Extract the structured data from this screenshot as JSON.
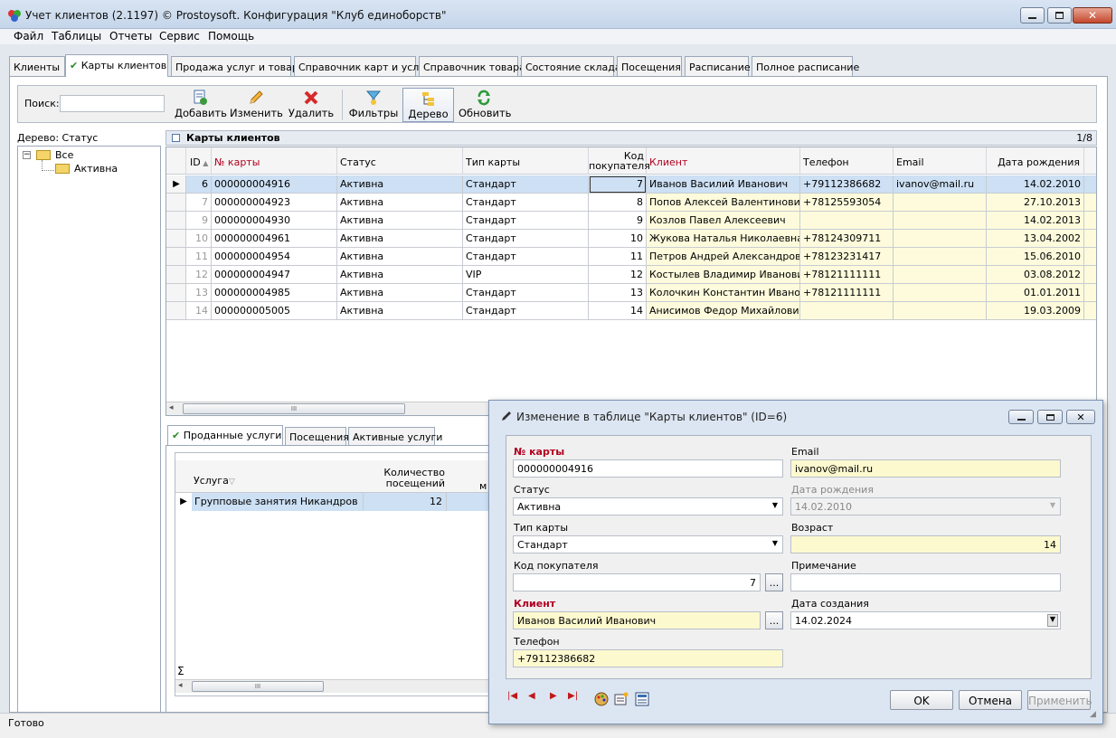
{
  "window": {
    "title": "Учет клиентов (2.1197) © Prostoysoft. Конфигурация \"Клуб единоборств\""
  },
  "menu": [
    "Файл",
    "Таблицы",
    "Отчеты",
    "Сервис",
    "Помощь"
  ],
  "tabs": [
    {
      "label": "Клиенты"
    },
    {
      "label": "Карты клиентов",
      "checkmark": "✔"
    },
    {
      "label": "Продажа услуг и товара"
    },
    {
      "label": "Справочник карт и услуг"
    },
    {
      "label": "Справочник товара"
    },
    {
      "label": "Состояние склада"
    },
    {
      "label": "Посещения"
    },
    {
      "label": "Расписание"
    },
    {
      "label": "Полное расписание"
    }
  ],
  "toolbar": {
    "search_label": "Поиск:",
    "search_value": "",
    "add": "Добавить",
    "edit": "Изменить",
    "delete": "Удалить",
    "filters": "Фильтры",
    "tree": "Дерево",
    "refresh": "Обновить"
  },
  "tree": {
    "title": "Дерево: Статус",
    "expander": "−",
    "root": "Все",
    "child": "Активна"
  },
  "grid": {
    "title": "Карты клиентов",
    "pager": "1/8",
    "row_pointer": "▶",
    "columns": {
      "id": "ID",
      "card_no": "№ карты",
      "status": "Статус",
      "card_type": "Тип карты",
      "buyer_code": "Код покупателя",
      "client": "Клиент",
      "phone": "Телефон",
      "email": "Email",
      "birthdate": "Дата рождения"
    },
    "rows": [
      {
        "id": "6",
        "card": "000000004916",
        "status": "Активна",
        "type": "Стандарт",
        "code": "7",
        "client": "Иванов Василий Иванович",
        "phone": "+79112386682",
        "email": "ivanov@mail.ru",
        "birth": "14.02.2010"
      },
      {
        "id": "7",
        "card": "000000004923",
        "status": "Активна",
        "type": "Стандарт",
        "code": "8",
        "client": "Попов Алексей Валентинович",
        "phone": "+78125593054",
        "email": "",
        "birth": "27.10.2013"
      },
      {
        "id": "9",
        "card": "000000004930",
        "status": "Активна",
        "type": "Стандарт",
        "code": "9",
        "client": "Козлов Павел Алексеевич",
        "phone": "",
        "email": "",
        "birth": "14.02.2013"
      },
      {
        "id": "10",
        "card": "000000004961",
        "status": "Активна",
        "type": "Стандарт",
        "code": "10",
        "client": "Жукова Наталья Николаевна",
        "phone": "+78124309711",
        "email": "",
        "birth": "13.04.2002"
      },
      {
        "id": "11",
        "card": "000000004954",
        "status": "Активна",
        "type": "Стандарт",
        "code": "11",
        "client": "Петров Андрей Александрович",
        "phone": "+78123231417",
        "email": "",
        "birth": "15.06.2010"
      },
      {
        "id": "12",
        "card": "000000004947",
        "status": "Активна",
        "type": "VIP",
        "code": "12",
        "client": "Костылев Владимир Иванович",
        "phone": "+78121111111",
        "email": "",
        "birth": "03.08.2012"
      },
      {
        "id": "13",
        "card": "000000004985",
        "status": "Активна",
        "type": "Стандарт",
        "code": "13",
        "client": "Колочкин Константин Иванович",
        "phone": "+78121111111",
        "email": "",
        "birth": "01.01.2011"
      },
      {
        "id": "14",
        "card": "000000005005",
        "status": "Активна",
        "type": "Стандарт",
        "code": "14",
        "client": "Анисимов Федор Михайлович",
        "phone": "",
        "email": "",
        "birth": "19.03.2009"
      }
    ],
    "scroll_grip": "III"
  },
  "subtabs": [
    {
      "label": "Проданные услуги",
      "checkmark": "✔"
    },
    {
      "label": "Посещения"
    },
    {
      "label": "Активные услуги"
    }
  ],
  "subgrid": {
    "col_service": "Услуга",
    "col_count": "Количество посещений",
    "col_more": "м",
    "row_service": "Групповые занятия Никандров",
    "row_count": "12",
    "total_mark": "Σ",
    "scroll_grip": "III"
  },
  "status": {
    "text": "Готово"
  },
  "dialog": {
    "title": "Изменение в таблице \"Карты клиентов\" (ID=6)",
    "fields": {
      "card_no_label": "№ карты",
      "card_no": "000000004916",
      "status_label": "Статус",
      "status": "Активна",
      "type_label": "Тип карты",
      "type": "Стандарт",
      "code_label": "Код покупателя",
      "code": "7",
      "client_label": "Клиент",
      "client": "Иванов Василий Иванович",
      "phone_label": "Телефон",
      "phone": "+79112386682",
      "email_label": "Email",
      "email": "ivanov@mail.ru",
      "birth_label": "Дата рождения",
      "birth": "14.02.2010",
      "age_label": "Возраст",
      "age": "14",
      "note_label": "Примечание",
      "note": "",
      "created_label": "Дата создания",
      "created": "14.02.2024",
      "ellipsis": "..."
    },
    "buttons": {
      "ok": "OK",
      "cancel": "Отмена",
      "apply": "Применить"
    },
    "nav": {
      "first": "|◀",
      "prev": "◀",
      "next": "▶",
      "last": "▶|"
    }
  },
  "colors": {
    "accent_red": "#b00020",
    "selection": "#cde0f4",
    "required_bg": "#fdf9cf"
  }
}
